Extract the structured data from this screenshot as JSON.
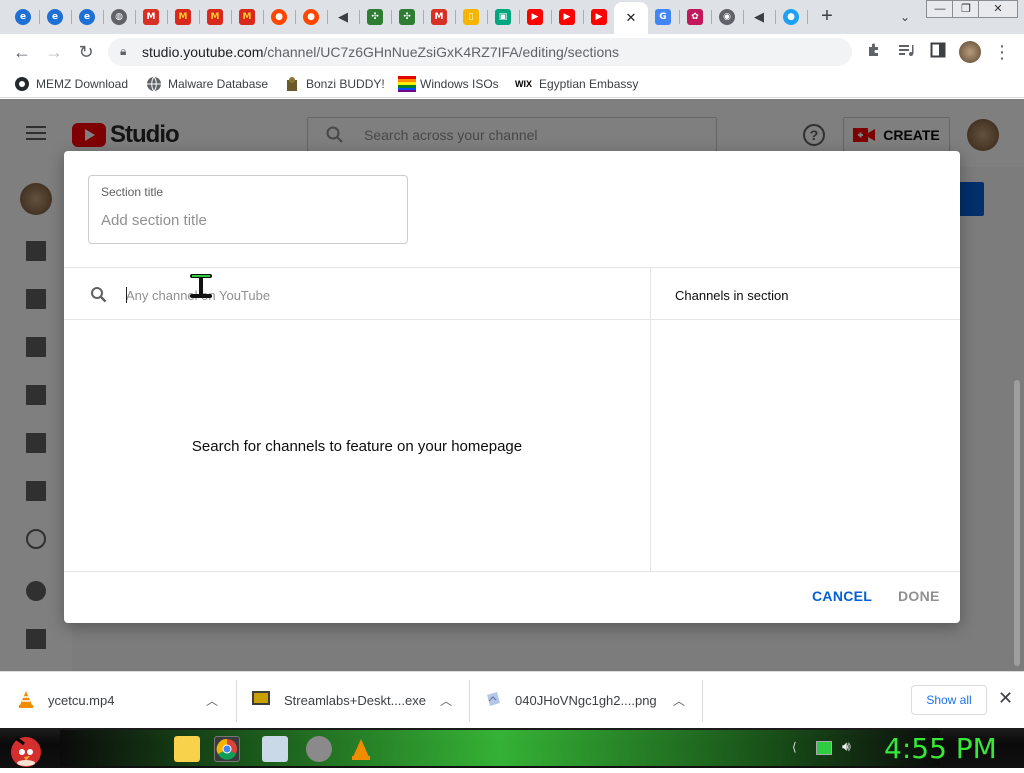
{
  "browser": {
    "tabs": [
      {
        "icon": "ie-icon",
        "color": "#1e6fd6"
      },
      {
        "icon": "ie-icon",
        "color": "#1e6fd6"
      },
      {
        "icon": "ie-icon",
        "color": "#1e6fd6"
      },
      {
        "icon": "globe-icon",
        "color": "#5f6368"
      },
      {
        "icon": "gmail-icon",
        "color": "#d93025"
      },
      {
        "icon": "mcdonalds-icon",
        "color": "#da291c"
      },
      {
        "icon": "mcdonalds-icon",
        "color": "#da291c"
      },
      {
        "icon": "mcdonalds-icon",
        "color": "#da291c"
      },
      {
        "icon": "reddit-icon",
        "color": "#ff4500"
      },
      {
        "icon": "reddit-icon",
        "color": "#ff4500"
      },
      {
        "icon": "audio-icon",
        "color": "#3c4043"
      },
      {
        "icon": "puzzle-icon",
        "color": "#2e7d32"
      },
      {
        "icon": "puzzle-icon",
        "color": "#2e7d32"
      },
      {
        "icon": "gmail-icon",
        "color": "#d93025"
      },
      {
        "icon": "doc-icon",
        "color": "#f4b400"
      },
      {
        "icon": "tv-icon",
        "color": "#00a67e"
      },
      {
        "icon": "youtube-icon",
        "color": "#ff0000"
      },
      {
        "icon": "youtube-icon",
        "color": "#ff0000"
      },
      {
        "icon": "youtube-icon",
        "color": "#ff0000"
      },
      {
        "icon": "close-icon",
        "color": "#202124",
        "active": true
      },
      {
        "icon": "google-icon",
        "color": "#4285f4"
      },
      {
        "icon": "flower-icon",
        "color": "#c2185b"
      },
      {
        "icon": "chrome-icon",
        "color": "#5f6368"
      },
      {
        "icon": "audio-icon",
        "color": "#3c4043"
      },
      {
        "icon": "circle-icon",
        "color": "#1da1f2"
      }
    ],
    "url_host": "studio.youtube.com",
    "url_path": "/channel/UC7z6GHnNueZsiGxK4RZ7IFA/editing/sections",
    "bookmarks": [
      {
        "label": "MEMZ Download",
        "icon": "github-icon"
      },
      {
        "label": "Malware Database",
        "icon": "globe-icon"
      },
      {
        "label": "Bonzi BUDDY!",
        "icon": "bonzi-icon"
      },
      {
        "label": "Windows ISOs",
        "icon": "windows-icon"
      },
      {
        "label": "Egyptian Embassy",
        "icon": "wix-icon"
      }
    ]
  },
  "studio": {
    "logo_text": "Studio",
    "search_placeholder": "Search across your channel",
    "create_label": "CREATE"
  },
  "dialog": {
    "section_title_label": "Section title",
    "section_title_placeholder": "Add section title",
    "search_placeholder": "Any channel on YouTube",
    "channels_header": "Channels in section",
    "empty_message": "Search for channels to feature on your homepage",
    "cancel_label": "CANCEL",
    "done_label": "DONE"
  },
  "downloads": {
    "items": [
      {
        "name": "ycetcu.mp4"
      },
      {
        "name": "Streamlabs+Deskt....exe"
      },
      {
        "name": "040JHoVNgc1gh2....png"
      }
    ],
    "show_all_label": "Show all"
  },
  "taskbar": {
    "clock": "4:55 PM"
  }
}
